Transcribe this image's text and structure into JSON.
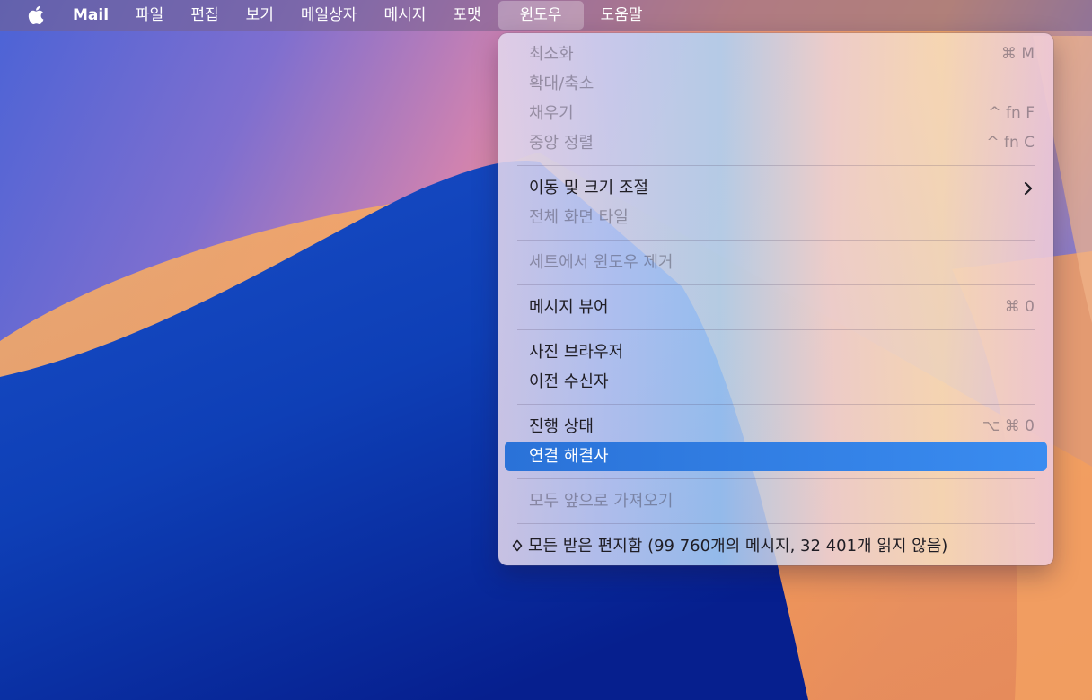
{
  "menubar": {
    "app_name": "Mail",
    "items": [
      "파일",
      "편집",
      "보기",
      "메일상자",
      "메시지",
      "포맷",
      "윈도우",
      "도움말"
    ],
    "active_item": "윈도우"
  },
  "window_menu": {
    "groups": [
      {
        "items": [
          {
            "label": "최소화",
            "shortcut": "⌘ M",
            "enabled": false
          },
          {
            "label": "확대/축소",
            "shortcut": "",
            "enabled": false
          },
          {
            "label": "채우기",
            "shortcut": "^ fn F",
            "enabled": false
          },
          {
            "label": "중앙 정렬",
            "shortcut": "^ fn C",
            "enabled": false
          }
        ]
      },
      {
        "items": [
          {
            "label": "이동 및 크기 조절",
            "submenu": true,
            "enabled": true
          },
          {
            "label": "전체 화면 타일",
            "shortcut": "",
            "enabled": false
          }
        ]
      },
      {
        "items": [
          {
            "label": "세트에서 윈도우 제거",
            "shortcut": "",
            "enabled": false
          }
        ]
      },
      {
        "items": [
          {
            "label": "메시지 뷰어",
            "shortcut": "⌘ 0",
            "enabled": true
          }
        ]
      },
      {
        "items": [
          {
            "label": "사진 브라우저",
            "shortcut": "",
            "enabled": true
          },
          {
            "label": "이전 수신자",
            "shortcut": "",
            "enabled": true
          }
        ]
      },
      {
        "items": [
          {
            "label": "진행 상태",
            "shortcut": "⌥ ⌘ 0",
            "enabled": true
          },
          {
            "label": "연결 해결사",
            "shortcut": "",
            "enabled": true,
            "highlighted": true
          }
        ]
      },
      {
        "items": [
          {
            "label": "모두 앞으로 가져오기",
            "shortcut": "",
            "enabled": false
          }
        ]
      },
      {
        "items": [
          {
            "label": "모든 받은 편지함 (99 760개의 메시지, 32 401개 읽지 않음)",
            "document": true,
            "enabled": true
          }
        ]
      }
    ]
  },
  "colors": {
    "highlight": "#2f7fe6",
    "menubar_text": "#ffffff"
  },
  "icons": {
    "apple": "apple-logo-icon",
    "submenu": "chevron-right-icon",
    "document": "diamond-icon"
  }
}
